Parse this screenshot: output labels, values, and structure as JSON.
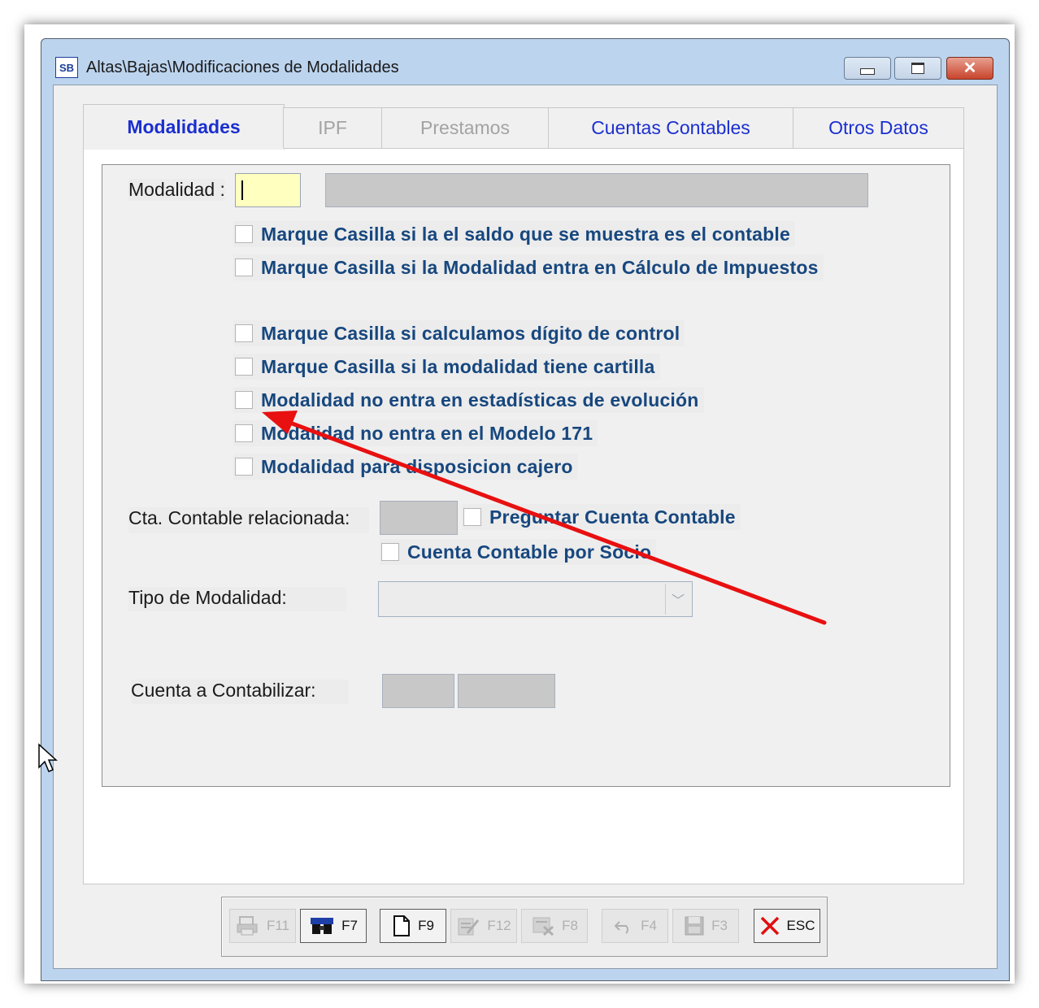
{
  "window": {
    "app_badge": "SB",
    "title": "Altas\\Bajas\\Modificaciones de Modalidades"
  },
  "tabs": [
    {
      "label": "Modalidades"
    },
    {
      "label": "IPF"
    },
    {
      "label": "Prestamos"
    },
    {
      "label": "Cuentas Contables"
    },
    {
      "label": "Otros Datos"
    }
  ],
  "form": {
    "modalidad_label": "Modalidad :",
    "modalidad_value": "",
    "modalidad_desc": "",
    "checkboxes": [
      {
        "label": "Marque Casilla si la el saldo que se muestra es el contable",
        "checked": false
      },
      {
        "label": "Marque Casilla si la Modalidad entra en Cálculo de Impuestos",
        "checked": false
      },
      {
        "label": "Marque Casilla si calculamos dígito de control",
        "checked": false
      },
      {
        "label": "Marque Casilla si la modalidad tiene cartilla",
        "checked": false
      },
      {
        "label": "Modalidad no entra en estadísticas de evolución",
        "checked": false
      },
      {
        "label": "Modalidad no entra en  el Modelo 171",
        "checked": false
      },
      {
        "label": "Modalidad para disposicion cajero",
        "checked": false
      }
    ],
    "cta_contable_label": "Cta. Contable relacionada:",
    "preguntar_label": "Preguntar Cuenta Contable",
    "por_socio_label": "Cuenta Contable por Socio",
    "tipo_label": "Tipo de Modalidad:",
    "tipo_value": "",
    "cuenta_contabilizar_label": "Cuenta a Contabilizar:"
  },
  "toolbar": {
    "buttons": [
      {
        "key": "F11",
        "icon": "printer-icon",
        "enabled": false
      },
      {
        "key": "F7",
        "icon": "binoculars-icon",
        "enabled": true
      },
      {
        "key": "F9",
        "icon": "new-document-icon",
        "enabled": true
      },
      {
        "key": "F12",
        "icon": "edit-document-icon",
        "enabled": false
      },
      {
        "key": "F8",
        "icon": "delete-record-icon",
        "enabled": false
      },
      {
        "key": "F4",
        "icon": "undo-icon",
        "enabled": false
      },
      {
        "key": "F3",
        "icon": "save-icon",
        "enabled": false
      },
      {
        "key": "ESC",
        "icon": "close-x-icon",
        "enabled": true
      }
    ]
  },
  "colors": {
    "tab_active": "#1b2fd0",
    "checkbox_label": "#17477e",
    "annotation_arrow": "#e81010",
    "input_focus": "#ffffc0"
  }
}
